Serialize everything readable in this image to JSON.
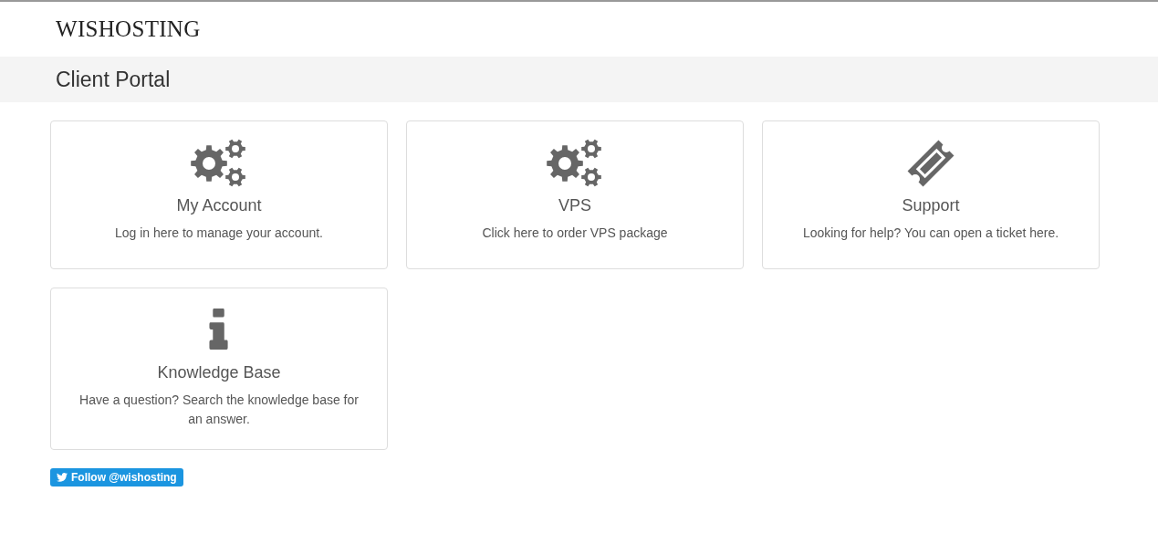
{
  "brand": "WISHOSTING",
  "page_title": "Client Portal",
  "cards": [
    {
      "kind": "gears",
      "title": "My Account",
      "description": "Log in here to manage your account."
    },
    {
      "kind": "gears",
      "title": "VPS",
      "description": "Click here to order VPS package"
    },
    {
      "kind": "ticket",
      "title": "Support",
      "description": "Looking for help? You can open a ticket here."
    },
    {
      "kind": "info",
      "title": "Knowledge Base",
      "description": "Have a question? Search the knowledge base for an answer."
    }
  ],
  "follow_button": {
    "label": "Follow @wishosting"
  }
}
